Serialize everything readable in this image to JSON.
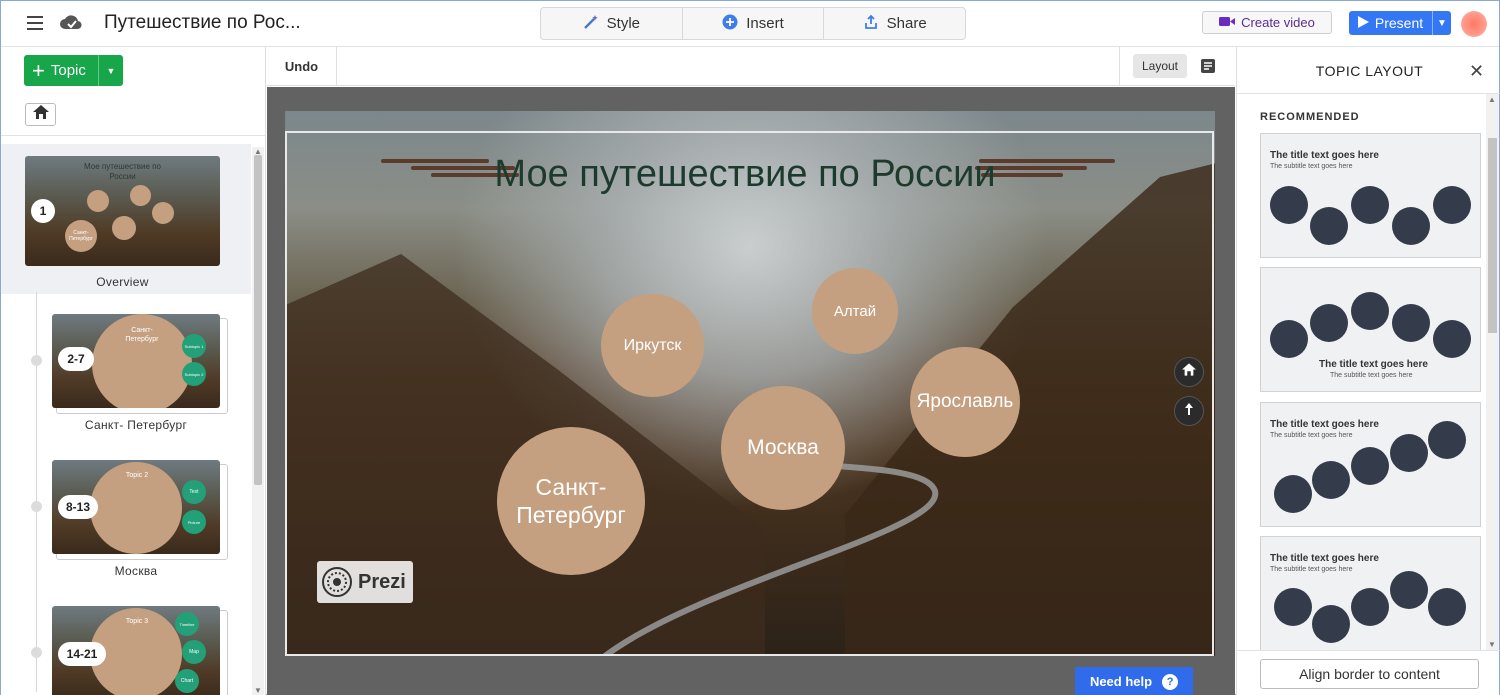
{
  "header": {
    "doc_title": "Путешествие по Рос...",
    "segments": [
      {
        "label": "Style",
        "icon": "magic-wand-icon"
      },
      {
        "label": "Insert",
        "icon": "plus-circle-icon"
      },
      {
        "label": "Share",
        "icon": "share-upload-icon"
      }
    ],
    "create_video_label": "Create video",
    "present_label": "Present"
  },
  "left_panel": {
    "topic_button_label": "Topic",
    "overview": {
      "badge": "1",
      "label": "Overview",
      "thumb_title": "Мое путешествие по России",
      "thumb_circle": "Санкт-Петербург"
    },
    "topics": [
      {
        "badge": "2-7",
        "label": "Санкт- Петербург",
        "thumb_title": "Санкт-\nПетербург",
        "sub": [
          "Subtopic 1",
          "Subtopic 2"
        ]
      },
      {
        "badge": "8-13",
        "label": "Москва",
        "thumb_title": "Topic 2",
        "sub": [
          "Text",
          "Picture"
        ]
      },
      {
        "badge": "14-21",
        "label": "",
        "thumb_title": "Topic 3",
        "sub": [
          "Timeline",
          "Map",
          "Chart"
        ]
      }
    ]
  },
  "toolbar": {
    "undo_label": "Undo",
    "layout_label": "Layout"
  },
  "slide": {
    "title": "Мое путешествие по России",
    "circles": [
      {
        "label": "Иркутск"
      },
      {
        "label": "Алтай"
      },
      {
        "label": "Ярославль"
      },
      {
        "label": "Москва"
      },
      {
        "label": "Санкт-\nПетербург"
      }
    ],
    "logo_text": "Prezi"
  },
  "need_help_label": "Need help",
  "right_panel": {
    "title": "TOPIC LAYOUT",
    "section_label": "RECOMMENDED",
    "card_title": "The title text goes here",
    "card_subtitle": "The subtitle text goes here",
    "align_button_label": "Align border to content"
  },
  "colors": {
    "accent_green": "#18a64a",
    "present_blue": "#3477f5",
    "help_blue": "#2f6bea",
    "circle_tan": "#c4a080",
    "title_green": "#1d3b2c",
    "layout_dot": "#343b4b"
  }
}
